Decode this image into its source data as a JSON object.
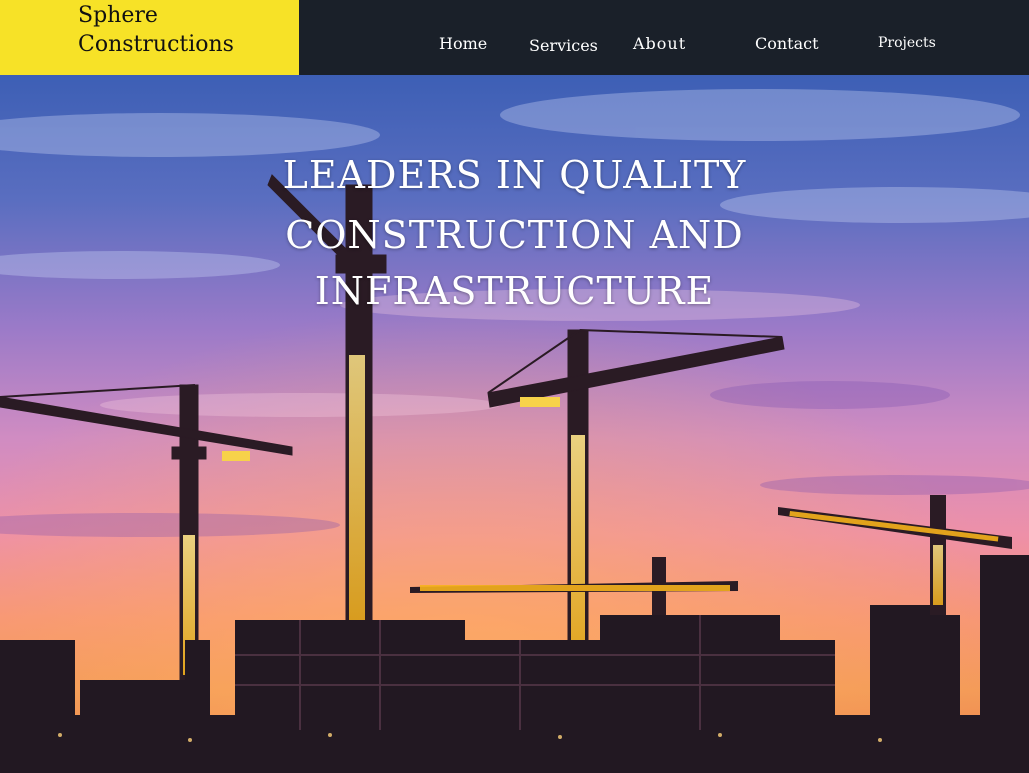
{
  "brand": {
    "line1": "Sphere",
    "line2": "Constructions"
  },
  "nav": [
    {
      "label": "Home"
    },
    {
      "label": "Services"
    },
    {
      "label": "About"
    },
    {
      "label": "Contact"
    },
    {
      "label": "Projects"
    }
  ],
  "hero": {
    "headline_lines": [
      "LEADERS IN QUALITY",
      "CONSTRUCTION AND",
      "INFRASTRUCTURE"
    ],
    "image_description_icon": "construction-cranes-sunset"
  },
  "colors": {
    "header_bg": "#1a2029",
    "logo_bg": "#f7e227",
    "headline": "#ffffff"
  }
}
